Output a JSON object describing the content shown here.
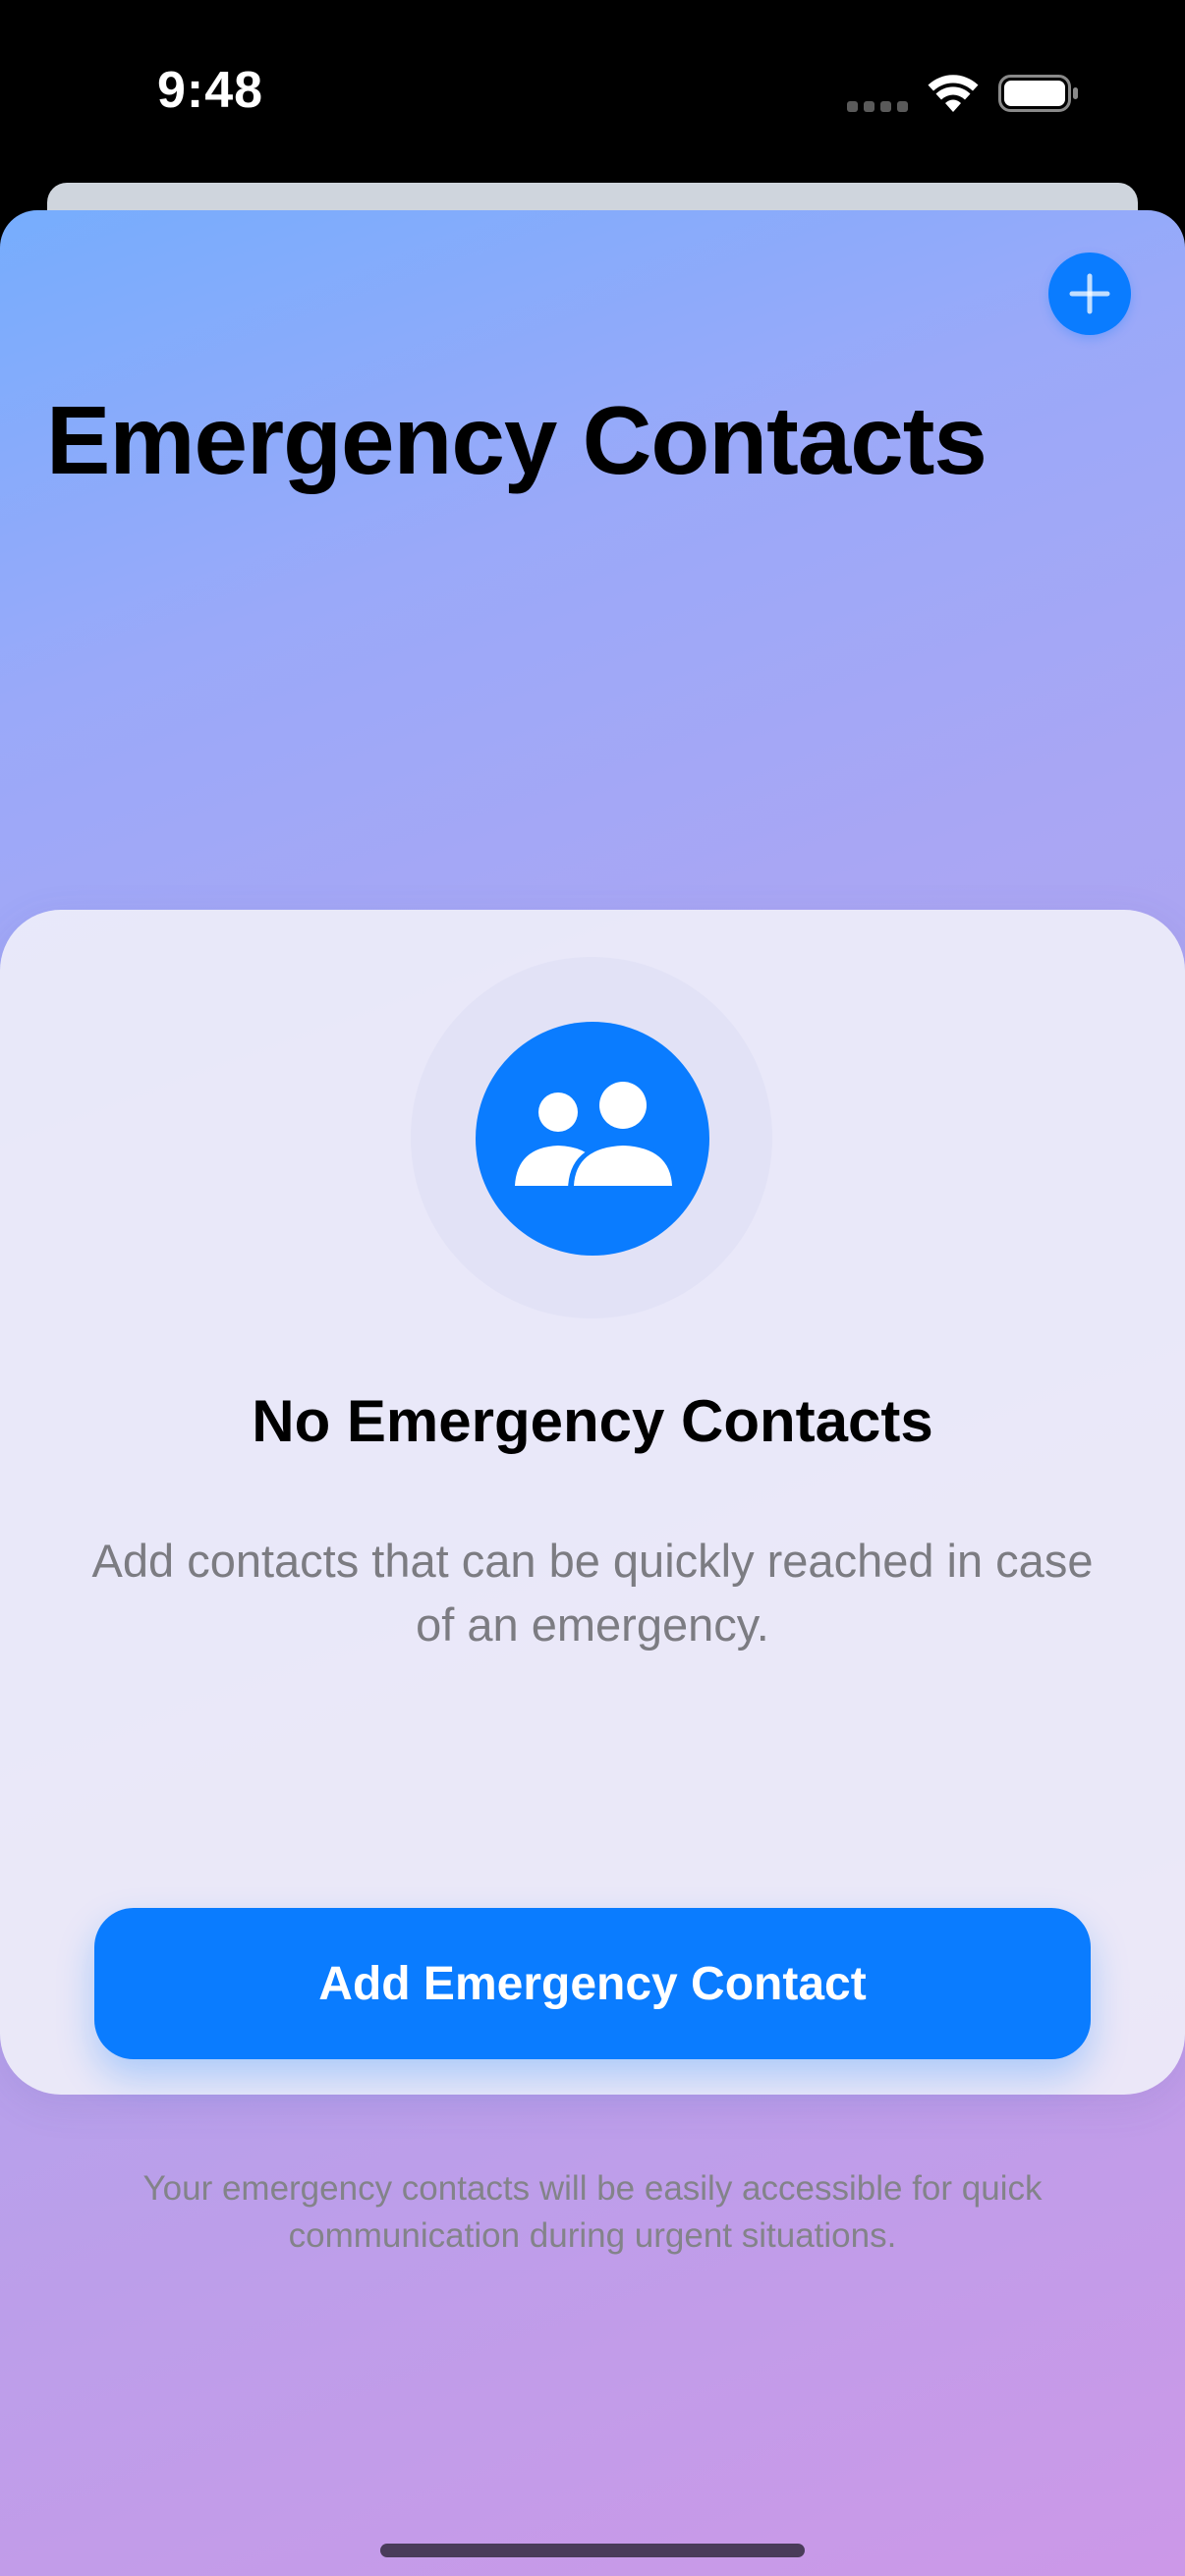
{
  "status_bar": {
    "time": "9:48"
  },
  "header": {
    "title": "Emergency Contacts",
    "add_button_icon": "plus-icon"
  },
  "empty_state": {
    "icon": "person-2-fill-icon",
    "title": "No Emergency Contacts",
    "description": "Add contacts that can be quickly reached in case of an emergency.",
    "primary_button_label": "Add Emergency Contact",
    "footnote": "Your emergency contacts will be easily accessible for quick communication during urgent situations."
  },
  "colors": {
    "accent": "#0A7CFF",
    "gradient_top": "#76ADFD",
    "gradient_bottom": "#CC98E8",
    "card_background": "#F0F0FA",
    "secondary_text": "#7C7C82"
  }
}
